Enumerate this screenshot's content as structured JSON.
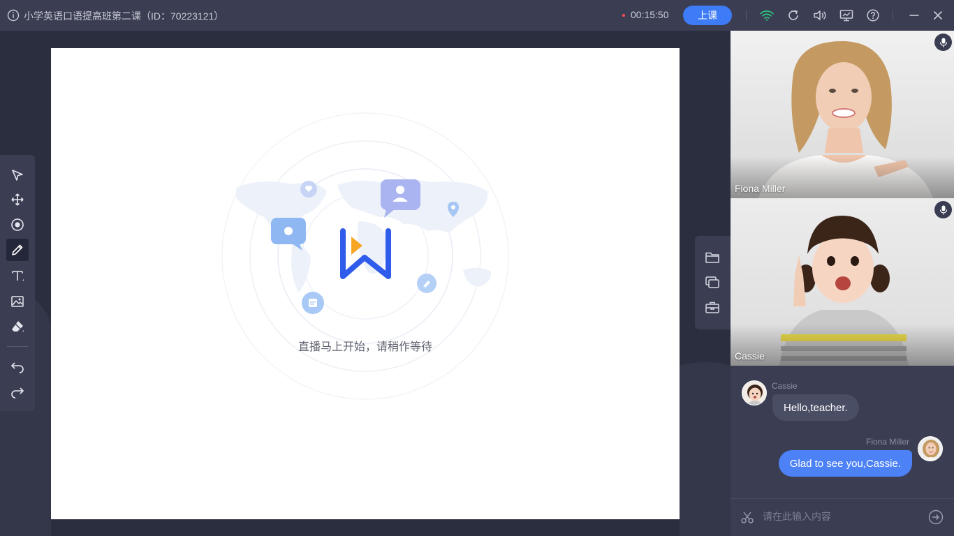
{
  "titlebar": {
    "title": "小学英语口语提高班第二课（ID：70223121）",
    "timer": "00:15:50",
    "start_label": "上课",
    "icons": [
      "info-icon",
      "wifi-icon",
      "refresh-icon",
      "volume-icon",
      "screen-share-icon",
      "help-icon",
      "minimize-icon",
      "close-icon"
    ]
  },
  "whiteboard": {
    "wait_text": "直播马上开始，请稍作等待",
    "logo": "W"
  },
  "toolbar": {
    "tools": [
      "select-tool",
      "move-tool",
      "laser-pointer-tool",
      "pen-tool",
      "text-tool",
      "image-tool",
      "eraser-tool",
      "undo-tool",
      "redo-tool"
    ],
    "active": "pen-tool"
  },
  "float_panel": {
    "icons": [
      "folder-icon",
      "window-icon",
      "toolbox-icon"
    ]
  },
  "videos": [
    {
      "name": "Fiona Miller"
    },
    {
      "name": "Cassie"
    }
  ],
  "chat": {
    "messages": [
      {
        "sender": "Cassie",
        "text": "Hello,teacher."
      },
      {
        "sender": "Fiona Miller",
        "text": "Glad to see you,Cassie."
      }
    ],
    "input_placeholder": "请在此输入内容"
  },
  "colors": {
    "accent": "#3e7bf7",
    "titlebar_bg": "#3b3e53",
    "stage_bg": "#2b2e3f",
    "wifi": "#2ec07c"
  }
}
